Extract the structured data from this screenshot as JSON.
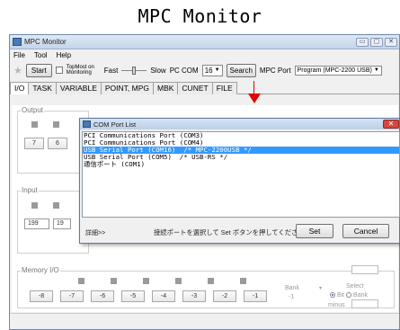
{
  "page_title": "MPC Monitor",
  "window": {
    "title": "MPC Monitor",
    "controls": [
      "▭",
      "▢",
      "✕"
    ]
  },
  "menu": [
    "File",
    "Tool",
    "Help"
  ],
  "toolbar": {
    "start_label": "Start",
    "topmost_label": "TopMost on Monitoring",
    "fast_label": "Fast",
    "slow_label": "Slow",
    "pc_com_label": "PC COM",
    "pc_com_value": "16",
    "search_label": "Search",
    "mpc_port_label": "MPC Port",
    "mpc_port_value": "Program (MPC-2200 USB)"
  },
  "tabs": [
    "I/O",
    "TASK",
    "VARIABLE",
    "POINT, MPG",
    "MBK",
    "CUNET",
    "FILE"
  ],
  "groups": {
    "output": "Output",
    "input": "Input",
    "memory": "Memory I/O"
  },
  "output_numbers": [
    "7",
    "6"
  ],
  "input_numbers": [
    "199",
    "19"
  ],
  "memory_buttons": [
    "-8",
    "-7",
    "-6",
    "-5",
    "-4",
    "-3",
    "-2",
    "-1"
  ],
  "bank": {
    "label": "Bank",
    "value": "-1",
    "select_label": "Select",
    "bit_label": "Bit",
    "bank_label": "Bank",
    "minus_label": "minus"
  },
  "dialog": {
    "title": "COM Port List",
    "close": "✕",
    "ports": [
      "PCI Communications Port (COM3)",
      "PCI Communications Port (COM4)",
      "USB Serial Port (COM16)  /* MPC-2200USB */",
      "USB Serial Port (COM5)  /* USB-RS */",
      "通信ポート (COM1)"
    ],
    "selected_index": 2,
    "detail_label": "詳細>>",
    "hint": "接続ポートを選択して Set ボタンを押してください。",
    "set_label": "Set",
    "cancel_label": "Cancel"
  },
  "colors": {
    "selection": "#3399ff",
    "arrow": "#e00000",
    "led": "#9a9a9a"
  }
}
